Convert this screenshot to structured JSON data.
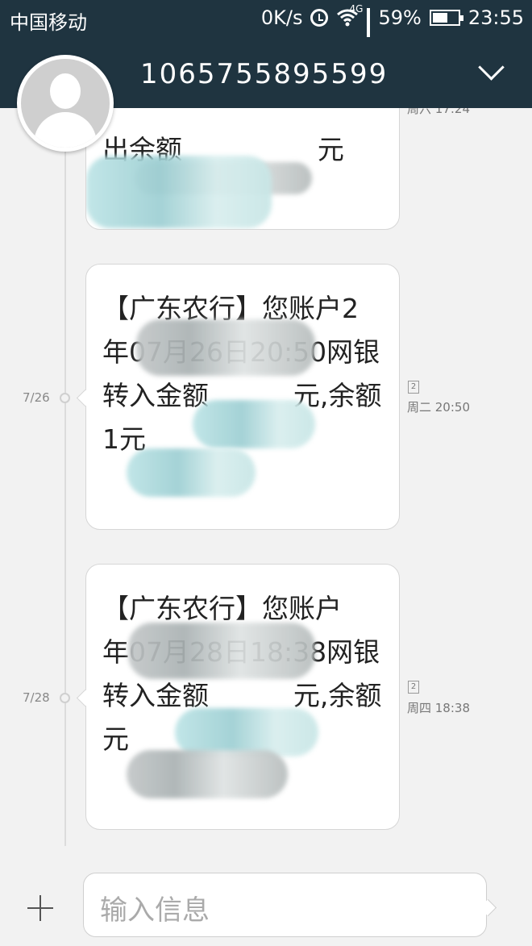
{
  "status_bar": {
    "carrier": "中国移动",
    "net_speed": "0K/s",
    "network_type": "4G",
    "battery": "59%",
    "time": "23:55"
  },
  "header": {
    "contact": "1065755895599",
    "avatar_icon": "contact-avatar",
    "menu_icon": "chevron-down-icon"
  },
  "messages": [
    {
      "text": "出余额                元",
      "date": "",
      "time": "周六 17:24",
      "sim": ""
    },
    {
      "text": "【广东农行】您账户2            年07月26日20:50网银转入金额          元,余额              1元",
      "date": "7/26",
      "time": "周二 20:50",
      "sim": "2"
    },
    {
      "text": "【广东农行】您账户            年07月28日18:38网银转入金额          元,余额              元",
      "date": "7/28",
      "time": "周四 18:38",
      "sim": "2"
    }
  ],
  "composer": {
    "placeholder": "输入信息"
  }
}
